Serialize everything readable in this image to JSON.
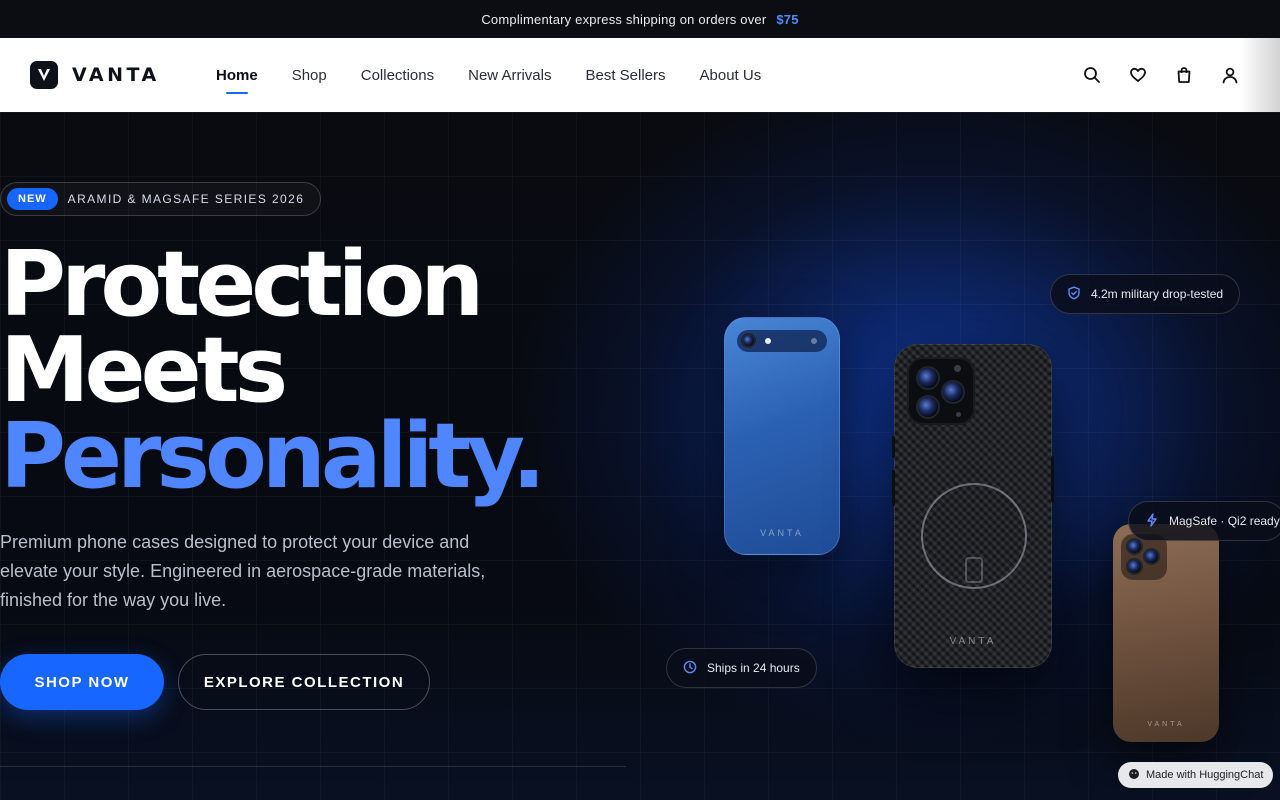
{
  "announcement": {
    "text": "Complimentary express shipping on orders over",
    "amount": "$75"
  },
  "header": {
    "logo_text": "VANTA",
    "nav": [
      {
        "label": "Home",
        "active": true
      },
      {
        "label": "Shop",
        "active": false
      },
      {
        "label": "Collections",
        "active": false
      },
      {
        "label": "New Arrivals",
        "active": false
      },
      {
        "label": "Best Sellers",
        "active": false
      },
      {
        "label": "About Us",
        "active": false
      }
    ],
    "icons": [
      "search-icon",
      "heart-icon",
      "bag-icon",
      "user-icon"
    ]
  },
  "hero": {
    "badge_label": "NEW",
    "badge_text": "ARAMID & MAGSAFE SERIES 2026",
    "headline_line1": "Protection",
    "headline_line2": "Meets",
    "headline_line3": "Personality.",
    "subtitle": "Premium phone cases designed to protect your device and elevate your style. Engineered in aerospace-grade materials, finished for the way you live.",
    "primary_cta": "SHOP NOW",
    "secondary_cta": "EXPLORE COLLECTION"
  },
  "showcase": {
    "phone_brand": "VANTA",
    "chip_drop": "4.2m military drop-tested",
    "chip_magsafe": "MagSafe · Qi2 ready",
    "chip_shipping": "Ships in 24 hours"
  },
  "footer_badge": "Made with HuggingChat",
  "colors": {
    "accent": "#1766ff",
    "accent_text": "#4f86ff",
    "background": "#07090f"
  }
}
